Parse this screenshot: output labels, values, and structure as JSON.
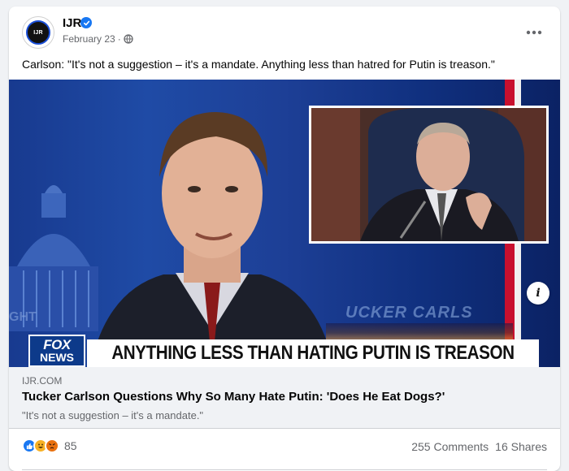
{
  "post": {
    "page_name": "IJR",
    "avatar_text": "IJR",
    "date": "February 23",
    "dot": "·",
    "text": "Carlson: \"It's not a suggestion – it's a mandate. Anything less than hatred for Putin is treason.\""
  },
  "media": {
    "network_logo_top": "FOX",
    "network_logo_bottom": "NEWS",
    "chyron": "ANYTHING LESS THAN HATING PUTIN IS TREASON",
    "show_overlay": "UCKER CARLS",
    "city_overlay": "GHT"
  },
  "link": {
    "domain": "IJR.COM",
    "title": "Tucker Carlson Questions Why So Many Hate Putin: 'Does He Eat Dogs?'",
    "description": "\"It's not a suggestion – it's a mandate.\""
  },
  "footer": {
    "reaction_count": "85",
    "comments": "255 Comments",
    "shares": "16 Shares"
  },
  "icons": {
    "verified": "verified-badge-icon",
    "globe": "globe-icon",
    "more": "more-options-icon",
    "info": "info-icon"
  },
  "colors": {
    "facebook_blue": "#1877f2",
    "fox_blue": "#0d3a8a",
    "stripe_red": "#c8102e"
  }
}
